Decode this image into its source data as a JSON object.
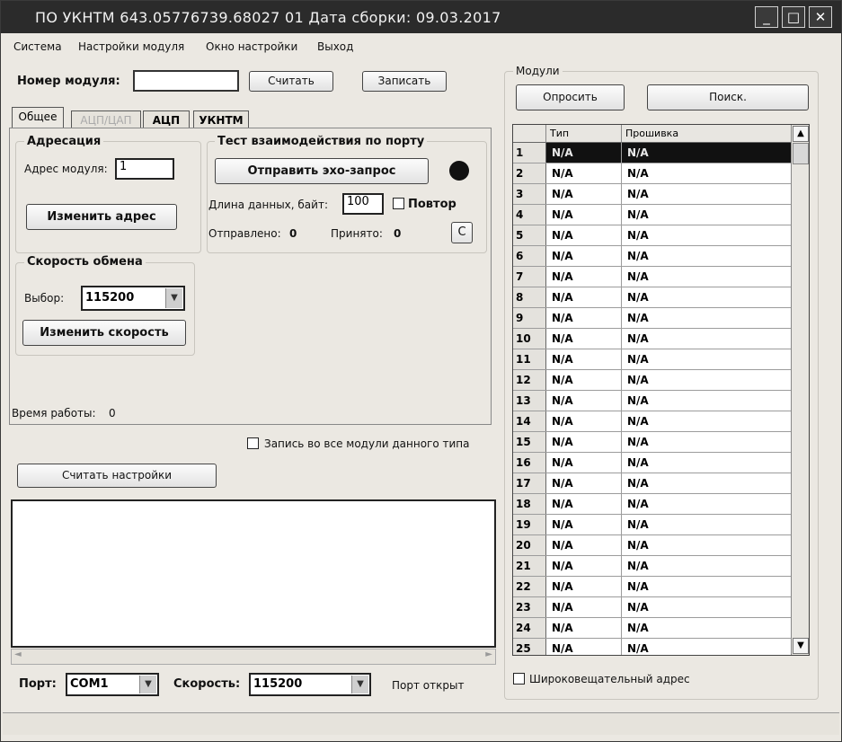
{
  "window": {
    "title": "ПО УКНТМ 643.05776739.68027 01 Дата сборки: 09.03.2017",
    "controls": [
      "_",
      "□",
      "✕"
    ]
  },
  "menu": [
    "Система",
    "Настройки модуля",
    "Окно настройки",
    "Выход"
  ],
  "module_bar": {
    "number_label": "Номер модуля:",
    "number_value": "",
    "read_button": "Считать",
    "write_button": "Записать"
  },
  "tabs": [
    "Общее",
    "АЦП/ЦАП",
    "АЦП",
    "УКНТМ"
  ],
  "addressing": {
    "title": "Адресация",
    "address_label": "Адрес модуля:",
    "address_value": "1",
    "change_button": "Изменить адрес"
  },
  "port_test": {
    "title": "Тест взаимодействия по порту",
    "echo_button": "Отправить эхо-запрос",
    "length_label": "Длина данных, байт:",
    "length_value": "100",
    "repeat_label": "Повтор",
    "sent_label": "Отправлено:",
    "sent_value": "0",
    "received_label": "Принято:",
    "received_value": "0",
    "clear_button": "C"
  },
  "speed": {
    "title": "Скорость обмена",
    "choice_label": "Выбор:",
    "choice_value": "115200",
    "change_button": "Изменить скорость"
  },
  "uptime": {
    "label": "Время работы:",
    "value": "0"
  },
  "write_all_label": "Запись во все модули данного типа",
  "read_settings_button": "Считать настройки",
  "bottom": {
    "port_label": "Порт:",
    "port_value": "COM1",
    "speed_label": "Скорость:",
    "speed_value": "115200",
    "port_status": "Порт открыт"
  },
  "modules": {
    "title": "Модули",
    "poll_button": "Опросить",
    "search_button": "Поиск.",
    "columns": [
      "Тип",
      "Прошивка"
    ],
    "rows": [
      {
        "n": "1",
        "type": "N/A",
        "fw": "N/A"
      },
      {
        "n": "2",
        "type": "N/A",
        "fw": "N/A"
      },
      {
        "n": "3",
        "type": "N/A",
        "fw": "N/A"
      },
      {
        "n": "4",
        "type": "N/A",
        "fw": "N/A"
      },
      {
        "n": "5",
        "type": "N/A",
        "fw": "N/A"
      },
      {
        "n": "6",
        "type": "N/A",
        "fw": "N/A"
      },
      {
        "n": "7",
        "type": "N/A",
        "fw": "N/A"
      },
      {
        "n": "8",
        "type": "N/A",
        "fw": "N/A"
      },
      {
        "n": "9",
        "type": "N/A",
        "fw": "N/A"
      },
      {
        "n": "10",
        "type": "N/A",
        "fw": "N/A"
      },
      {
        "n": "11",
        "type": "N/A",
        "fw": "N/A"
      },
      {
        "n": "12",
        "type": "N/A",
        "fw": "N/A"
      },
      {
        "n": "13",
        "type": "N/A",
        "fw": "N/A"
      },
      {
        "n": "14",
        "type": "N/A",
        "fw": "N/A"
      },
      {
        "n": "15",
        "type": "N/A",
        "fw": "N/A"
      },
      {
        "n": "16",
        "type": "N/A",
        "fw": "N/A"
      },
      {
        "n": "17",
        "type": "N/A",
        "fw": "N/A"
      },
      {
        "n": "18",
        "type": "N/A",
        "fw": "N/A"
      },
      {
        "n": "19",
        "type": "N/A",
        "fw": "N/A"
      },
      {
        "n": "20",
        "type": "N/A",
        "fw": "N/A"
      },
      {
        "n": "21",
        "type": "N/A",
        "fw": "N/A"
      },
      {
        "n": "22",
        "type": "N/A",
        "fw": "N/A"
      },
      {
        "n": "23",
        "type": "N/A",
        "fw": "N/A"
      },
      {
        "n": "24",
        "type": "N/A",
        "fw": "N/A"
      },
      {
        "n": "25",
        "type": "N/A",
        "fw": "N/A"
      }
    ],
    "broadcast_label": "Широковещательный адрес"
  }
}
